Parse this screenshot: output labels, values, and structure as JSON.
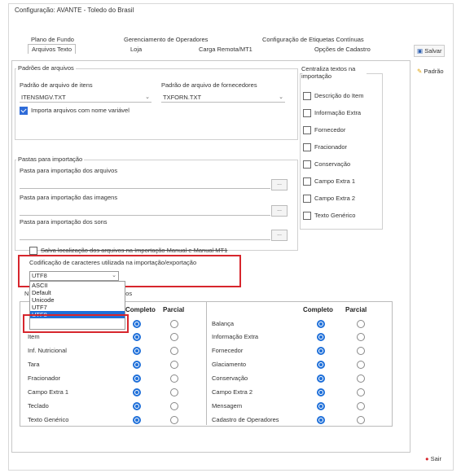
{
  "window": {
    "title": "Configuração: AVANTE - Toledo do Brasil"
  },
  "tabs": {
    "row1": [
      "Plano de Fundo",
      "Gerenciamento de Operadores",
      "Configuração de Etiquetas Contínuas"
    ],
    "row2": [
      "Arquivos Texto",
      "Loja",
      "Carga Remota/MT1",
      "Opções de Cadastro"
    ],
    "active": "Arquivos Texto"
  },
  "toolbar": {
    "save_label": "Salvar",
    "default_label": "Padrão",
    "exit_label": "Sair"
  },
  "patterns": {
    "group_title": "Padrões de arquivos",
    "item_label": "Padrão de arquivo de itens",
    "item_value": "ITENSMGV.TXT",
    "supplier_label": "Padrão de arquivo de fornecedores",
    "supplier_value": "TXFORN.TXT",
    "variable_name_label": "Importa arquivos com nome variável",
    "variable_name_checked": true
  },
  "center": {
    "group_title": "Centraliza textos na importação",
    "options": [
      "Descrição do Item",
      "Informação Extra",
      "Fornecedor",
      "Fracionador",
      "Conservação",
      "Campo Extra 1",
      "Campo Extra 2",
      "Texto Genérico"
    ]
  },
  "folders": {
    "group_title": "Pastas para importação",
    "files_label": "Pasta para importação dos arquivos",
    "images_label": "Pasta para importação das imagens",
    "sounds_label": "Pasta para importação dos sons",
    "browse_label": "...",
    "manual_label": "Salva localização dos arquivos na Importação Manual e Manual MT1"
  },
  "encoding": {
    "label": "Codificação de caracteres utilizada na importação/exportação",
    "selected": "UTF8",
    "options": [
      "ASCII",
      "Default",
      "Unicode",
      "UTF7",
      "UTF8"
    ]
  },
  "grid": {
    "section_prefix": "N",
    "section_suffix": "dos",
    "headers": {
      "complete": "Completo",
      "partial": "Parcial"
    },
    "left_rows": [
      {
        "label": "Item",
        "complete": true
      },
      {
        "label": "Inf. Nutricional",
        "complete": true
      },
      {
        "label": "Tara",
        "complete": true
      },
      {
        "label": "Fracionador",
        "complete": true
      },
      {
        "label": "Campo Extra 1",
        "complete": true
      },
      {
        "label": "Teclado",
        "complete": true
      },
      {
        "label": "Texto Genérico",
        "complete": true
      }
    ],
    "right_rows": [
      {
        "label": "Balança",
        "complete": true
      },
      {
        "label": "Informação Extra",
        "complete": true
      },
      {
        "label": "Fornecedor",
        "complete": true
      },
      {
        "label": "Glaciamento",
        "complete": true
      },
      {
        "label": "Conservação",
        "complete": true
      },
      {
        "label": "Campo Extra 2",
        "complete": true
      },
      {
        "label": "Mensagem",
        "complete": true
      },
      {
        "label": "Cadastro de Operadores",
        "complete": true
      }
    ]
  },
  "colors": {
    "accent": "#1e6fd9",
    "highlight": "#d7262d"
  }
}
